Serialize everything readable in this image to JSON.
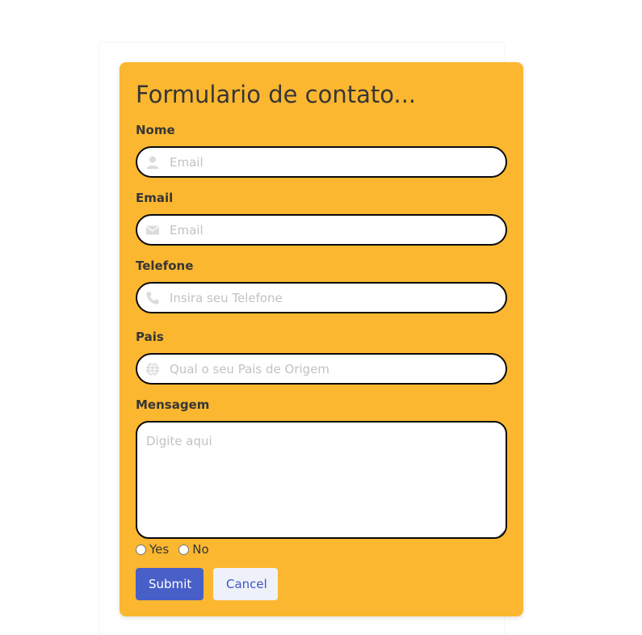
{
  "form": {
    "title": "Formulario de contato...",
    "fields": [
      {
        "label": "Nome",
        "placeholder": "Email",
        "icon": "user-icon"
      },
      {
        "label": "Email",
        "placeholder": "Email",
        "icon": "envelope-icon"
      },
      {
        "label": "Telefone",
        "placeholder": "Insira seu Telefone",
        "icon": "phone-icon"
      },
      {
        "label": "Pais",
        "placeholder": "Qual o seu Pais de Origem",
        "icon": "globe-icon"
      }
    ],
    "message": {
      "label": "Mensagem",
      "placeholder": "Digite aqui"
    },
    "radio": {
      "yes": "Yes",
      "no": "No"
    },
    "buttons": {
      "submit": "Submit",
      "cancel": "Cancel"
    }
  },
  "colors": {
    "form_background": "#fbb730",
    "submit_button": "#485fc7",
    "cancel_button_bg": "#eff1fa",
    "cancel_button_text": "#3e56c4",
    "input_border": "#0a0a0a",
    "text": "#363636"
  }
}
